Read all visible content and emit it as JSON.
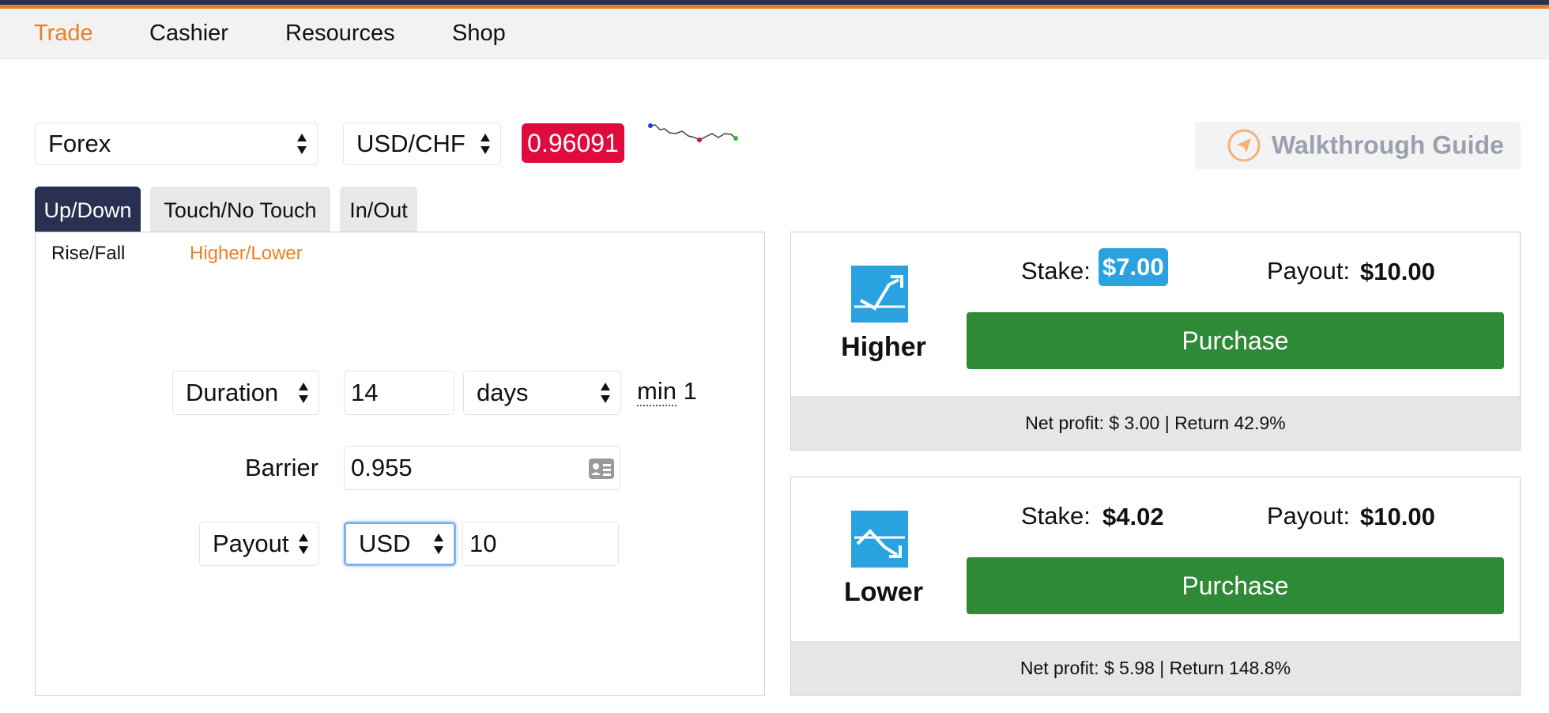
{
  "nav": {
    "items": [
      "Trade",
      "Cashier",
      "Resources",
      "Shop"
    ]
  },
  "controls": {
    "market": "Forex",
    "symbol": "USD/CHF",
    "spot": "0.96091",
    "walkthrough": "Walkthrough Guide"
  },
  "tabs": [
    "Up/Down",
    "Touch/No Touch",
    "In/Out"
  ],
  "subtabs": [
    "Rise/Fall",
    "Higher/Lower"
  ],
  "form": {
    "duration_select": "Duration",
    "duration_value": "14",
    "duration_unit": "days",
    "min_label": "min",
    "min_value": "1",
    "barrier_label": "Barrier",
    "barrier_value": "0.955",
    "amount_type": "Payout",
    "currency": "USD",
    "amount_value": "10"
  },
  "contracts": [
    {
      "name": "Higher",
      "stake_label": "Stake:",
      "stake": "$7.00",
      "payout_label": "Payout:",
      "payout": "$10.00",
      "purchase": "Purchase",
      "footer": "Net profit: $ 3.00 | Return 42.9%"
    },
    {
      "name": "Lower",
      "stake_label": "Stake:",
      "stake": "$4.02",
      "payout_label": "Payout:",
      "payout": "$10.00",
      "purchase": "Purchase",
      "footer": "Net profit: $ 5.98 | Return 148.8%"
    }
  ],
  "colors": {
    "accent": "#e98024",
    "navy": "#2a3052",
    "spot_red": "#e00a3c",
    "buy_green": "#2f8a37",
    "icon_blue": "#2aa2df"
  },
  "icons": {
    "sparkline": "sparkline-chart",
    "walkthrough": "navigation-arrow-icon",
    "barrier": "id-card-icon",
    "higher": "trend-up-icon",
    "lower": "trend-down-icon"
  }
}
